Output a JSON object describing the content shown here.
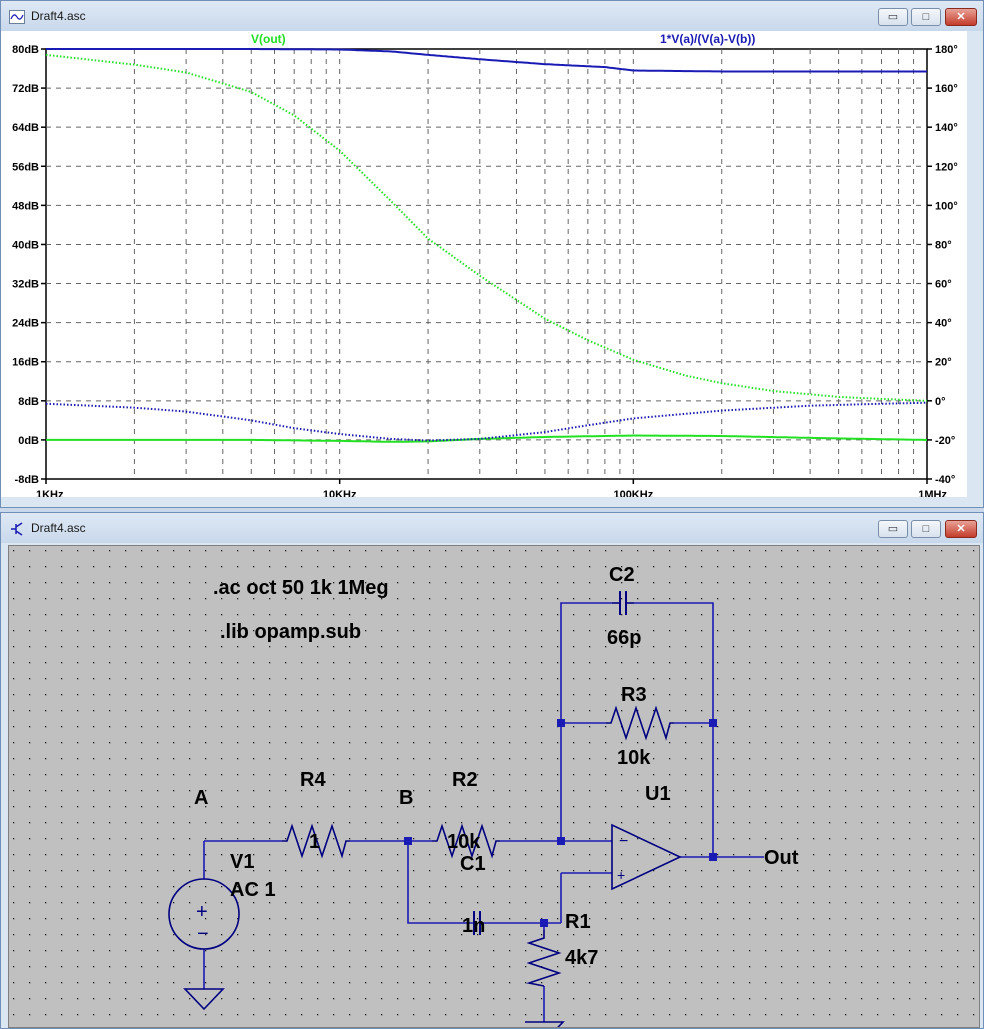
{
  "plot_window": {
    "title": "Draft4.asc",
    "icon": "waveform-icon",
    "buttons": {
      "minimize": "▭",
      "maximize": "□",
      "close": "✕"
    }
  },
  "schematic_window": {
    "title": "Draft4.asc",
    "icon": "transistor-icon",
    "buttons": {
      "minimize": "▭",
      "maximize": "□",
      "close": "✕"
    }
  },
  "chart_data": {
    "type": "line",
    "title": "",
    "xscale": "log",
    "xlim": [
      1000,
      1000000
    ],
    "x_ticks": [
      {
        "value": 1000,
        "label": "1KHz"
      },
      {
        "value": 10000,
        "label": "10KHz"
      },
      {
        "value": 100000,
        "label": "100KHz"
      },
      {
        "value": 1000000,
        "label": "1MHz"
      }
    ],
    "ylim_left": [
      -8,
      80
    ],
    "y_ticks_left": [
      "80dB",
      "72dB",
      "64dB",
      "56dB",
      "48dB",
      "40dB",
      "32dB",
      "24dB",
      "16dB",
      "8dB",
      "0dB",
      "-8dB"
    ],
    "ylim_right": [
      -40,
      180
    ],
    "y_ticks_right": [
      "180°",
      "160°",
      "140°",
      "120°",
      "100°",
      "80°",
      "60°",
      "40°",
      "20°",
      "0°",
      "-20°",
      "-40°"
    ],
    "grid": true,
    "colors": {
      "vout": "#22e022",
      "ratio": "#1a1ab4",
      "background": "#ffffff",
      "grid": "#666666"
    },
    "series": [
      {
        "name": "V(out)",
        "color": "#22e022",
        "legend_position": "top-left",
        "magnitude_db": [
          [
            1000,
            0
          ],
          [
            2000,
            0
          ],
          [
            5000,
            0
          ],
          [
            10000,
            -0.2
          ],
          [
            15000,
            -0.4
          ],
          [
            20000,
            -0.3
          ],
          [
            30000,
            0.2
          ],
          [
            50000,
            0.6
          ],
          [
            80000,
            0.8
          ],
          [
            100000,
            0.9
          ],
          [
            200000,
            0.8
          ],
          [
            500000,
            0.3
          ],
          [
            1000000,
            0
          ]
        ],
        "phase_deg": [
          [
            1000,
            177
          ],
          [
            2000,
            172
          ],
          [
            3000,
            168
          ],
          [
            5000,
            158
          ],
          [
            7000,
            146
          ],
          [
            10000,
            128
          ],
          [
            15000,
            102
          ],
          [
            20000,
            83
          ],
          [
            30000,
            64
          ],
          [
            50000,
            42
          ],
          [
            70000,
            31
          ],
          [
            100000,
            21
          ],
          [
            150000,
            13
          ],
          [
            200000,
            9
          ],
          [
            300000,
            5
          ],
          [
            500000,
            2
          ],
          [
            700000,
            1
          ],
          [
            1000000,
            0
          ]
        ]
      },
      {
        "name": "1*V(a)/(V(a)-V(b))",
        "color": "#1a1ab4",
        "legend_position": "top-right",
        "magnitude_db": [
          [
            1000,
            80
          ],
          [
            5000,
            80
          ],
          [
            10000,
            79.9
          ],
          [
            15000,
            79.5
          ],
          [
            20000,
            78.8
          ],
          [
            30000,
            77.9
          ],
          [
            50000,
            76.9
          ],
          [
            80000,
            76.3
          ],
          [
            100000,
            75.6
          ],
          [
            200000,
            75.4
          ],
          [
            500000,
            75.4
          ],
          [
            1000000,
            75.4
          ]
        ],
        "phase_deg": [
          [
            1000,
            -1.5
          ],
          [
            2000,
            -3.5
          ],
          [
            3000,
            -5.5
          ],
          [
            5000,
            -10
          ],
          [
            7000,
            -14
          ],
          [
            10000,
            -17
          ],
          [
            15000,
            -19.5
          ],
          [
            20000,
            -20.3
          ],
          [
            30000,
            -19.5
          ],
          [
            50000,
            -16
          ],
          [
            70000,
            -12.5
          ],
          [
            100000,
            -9
          ],
          [
            200000,
            -5
          ],
          [
            400000,
            -2.5
          ],
          [
            700000,
            -1.5
          ],
          [
            1000000,
            -1
          ]
        ]
      }
    ]
  },
  "schematic": {
    "directives": [
      ".ac oct 50 1k 1Meg",
      ".lib opamp.sub"
    ],
    "nets": {
      "a": "A",
      "b": "B",
      "out": "Out"
    },
    "components": {
      "C2": {
        "name": "C2",
        "value": "66p"
      },
      "R3": {
        "name": "R3",
        "value": "10k"
      },
      "R4": {
        "name": "R4",
        "value": "1"
      },
      "R2": {
        "name": "R2",
        "value": "10k"
      },
      "C1": {
        "name": "C1",
        "value": "1n"
      },
      "R1": {
        "name": "R1",
        "value": "4k7"
      },
      "U1": {
        "name": "U1",
        "minus": "−",
        "plus": "+"
      },
      "V1": {
        "name": "V1",
        "value": "AC 1",
        "plus": "+",
        "minus": "−"
      }
    },
    "colors": {
      "wire": "#1a1ab4",
      "component": "#000080",
      "node": "#1a1ab4",
      "background": "#c0c0c0",
      "text": "#000000"
    }
  }
}
